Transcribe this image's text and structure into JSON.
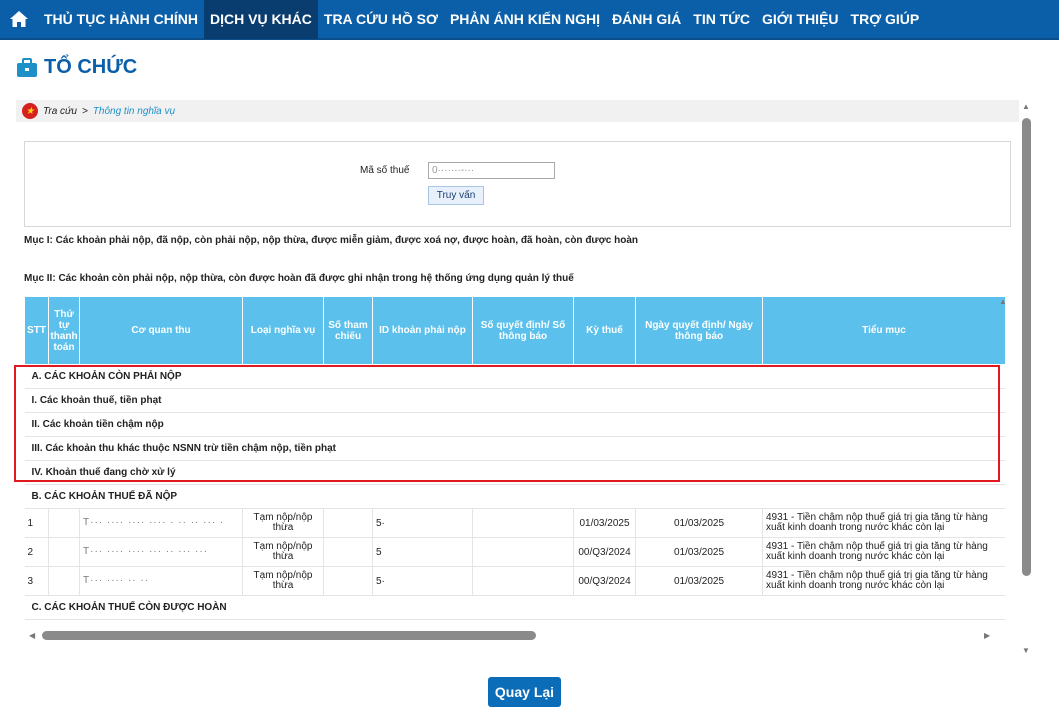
{
  "nav": {
    "items": [
      {
        "label": "THỦ TỤC HÀNH CHÍNH"
      },
      {
        "label": "DỊCH VỤ KHÁC"
      },
      {
        "label": "TRA CỨU HỒ SƠ"
      },
      {
        "label": "PHẢN ÁNH KIẾN NGHỊ"
      },
      {
        "label": "ĐÁNH GIÁ"
      },
      {
        "label": "TIN TỨC"
      },
      {
        "label": "GIỚI THIỆU"
      },
      {
        "label": "TRỢ GIÚP"
      }
    ],
    "active_index": 1
  },
  "page": {
    "title": "TỔ CHỨC",
    "icon": "briefcase-icon"
  },
  "breadcrumb": {
    "root": "Tra cứu",
    "sep": ">",
    "current": "Thông tin nghĩa vụ"
  },
  "search": {
    "label": "Mã số thuế",
    "value": "0·······-···",
    "button": "Truy vấn"
  },
  "notes": {
    "muc1": "Mục I: Các khoản phải nộp, đã nộp, còn phải nộp, nộp thừa, được miễn giảm, được xoá nợ, được hoàn, đã hoàn, còn được hoàn",
    "muc2": "Mục II: Các khoản còn phải nộp, nộp thừa, còn được hoàn đã được ghi nhận trong hệ thống ứng dụng quản lý thuế"
  },
  "table": {
    "headers": [
      "STT",
      "Thứ tự thanh toán",
      "Cơ quan thu",
      "Loại nghĩa vụ",
      "Số tham chiếu",
      "ID khoản phải nộp",
      "Số quyết định/ Số thông báo",
      "Kỳ thuế",
      "Ngày quyết định/ Ngày thông báo",
      "Tiểu mục"
    ],
    "groups": {
      "a": "A. CÁC KHOẢN CÒN PHẢI NỘP",
      "a1": "I. Các khoản thuế, tiền phạt",
      "a2": "II. Các khoản tiền chậm nộp",
      "a3": "III. Các khoản thu khác thuộc NSNN trừ tiền chậm nộp, tiền phạt",
      "a4": "IV. Khoản thuế đang chờ xử lý",
      "b": "B. CÁC KHOẢN THUẾ ĐÃ NỘP",
      "c": "C. CÁC KHOẢN THUẾ CÒN ĐƯỢC HOÀN"
    },
    "rows": [
      {
        "stt": "1",
        "co_quan": "T··· ···· ···· ···· · ·· ·· ··· ·",
        "loai": "Tạm nộp/nộp thừa",
        "id": "5·",
        "ky": "01/03/2025",
        "ngay": "01/03/2025",
        "tieu_muc": "4931 - Tiền chậm nộp thuế giá trị gia tăng từ hàng xuất kinh doanh trong nước khác còn lại"
      },
      {
        "stt": "2",
        "co_quan": "T··· ···· ···· ··· ·· ··· ···",
        "loai": "Tạm nộp/nộp thừa",
        "id": "5",
        "ky": "00/Q3/2024",
        "ngay": "01/03/2025",
        "tieu_muc": "4931 - Tiền chậm nộp thuế giá trị gia tăng từ hàng xuất kinh doanh trong nước khác còn lại"
      },
      {
        "stt": "3",
        "co_quan": "T··· ···· ·· ··",
        "loai": "Tạm nộp/nộp thừa",
        "id": "5·",
        "ky": "00/Q3/2024",
        "ngay": "01/03/2025",
        "tieu_muc": "4931 - Tiền chậm nộp thuế giá trị gia tăng từ hàng xuất kinh doanh trong nước khác còn lại"
      }
    ]
  },
  "back_button": "Quay Lại",
  "colors": {
    "nav": "#0b5fa8",
    "header": "#5bc0eb",
    "highlight": "#e1191f",
    "button": "#0b6cb8"
  }
}
